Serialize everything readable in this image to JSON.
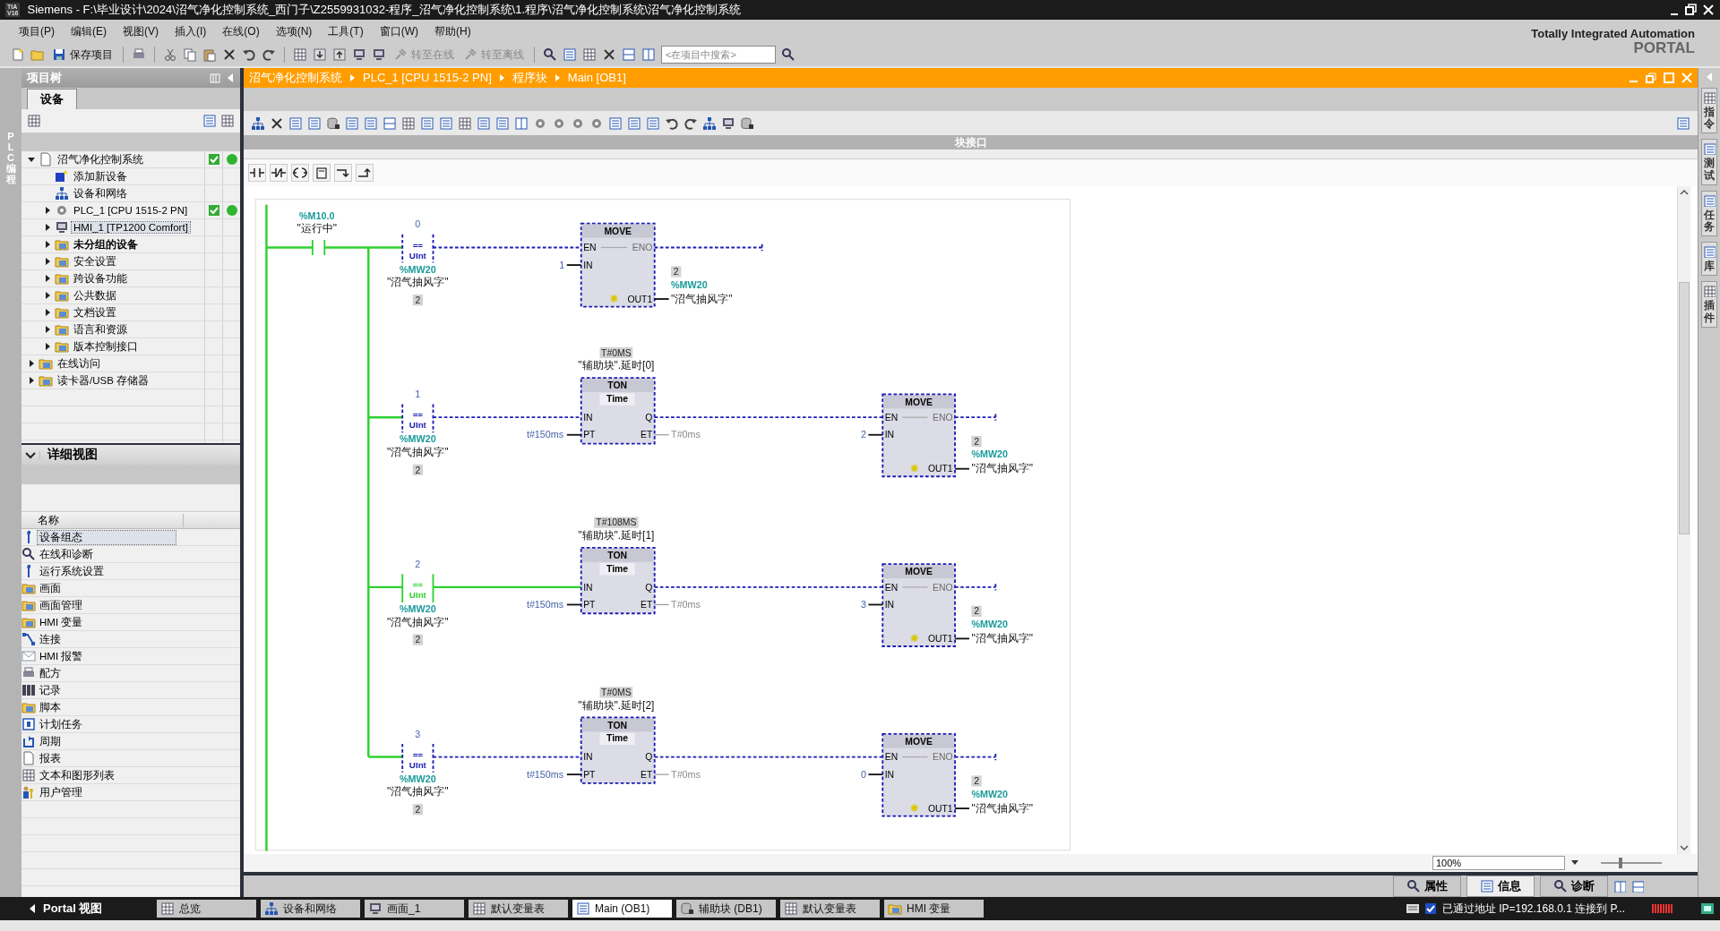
{
  "window": {
    "logo": [
      "TIA",
      "V16"
    ],
    "title": "Siemens  -  F:\\毕业设计\\2024\\沼气净化控制系统_西门子\\Z2559931032-程序_沼气净化控制系统\\1.程序\\沼气净化控制系统\\沼气净化控制系统"
  },
  "menu": [
    "项目(P)",
    "编辑(E)",
    "视图(V)",
    "插入(I)",
    "在线(O)",
    "选项(N)",
    "工具(T)",
    "窗口(W)",
    "帮助(H)"
  ],
  "toolbar": {
    "save_label": "保存项目",
    "go_online": {
      "label": "转至在线",
      "disabled": true
    },
    "go_offline": {
      "label": "转至离线",
      "disabled": true
    },
    "search": {
      "placeholder": "<在项目中搜索>"
    }
  },
  "brand": {
    "line1": "Totally Integrated Automation",
    "line2": "PORTAL"
  },
  "left_rail": {
    "label": "PLC 编程"
  },
  "project_tree": {
    "title": "项目树",
    "tabs": [
      {
        "label": "设备",
        "selected": true
      }
    ],
    "items": [
      {
        "label": "沼气净化控制系统",
        "kind": "folder",
        "expanded": true,
        "selected": false,
        "status_ok": true,
        "children": [
          {
            "label": "添加新设备",
            "kind": "action",
            "selected": false
          },
          {
            "label": "设备和网络",
            "kind": "action",
            "selected": false
          },
          {
            "label": "PLC_1 [CPU 1515-2 PN]",
            "kind": "folder",
            "expanded": false,
            "selected": false,
            "status_ok": true
          },
          {
            "label": "HMI_1 [TP1200 Comfort]",
            "kind": "folder",
            "expanded": false,
            "selected": true
          },
          {
            "label": "未分组的设备",
            "kind": "folder",
            "expanded": false,
            "selected": false,
            "bold": true
          },
          {
            "label": "安全设置",
            "kind": "folder",
            "expanded": false,
            "selected": false
          },
          {
            "label": "跨设备功能",
            "kind": "folder",
            "expanded": false,
            "selected": false
          },
          {
            "label": "公共数据",
            "kind": "folder",
            "expanded": false,
            "selected": false
          },
          {
            "label": "文档设置",
            "kind": "folder",
            "expanded": false,
            "selected": false
          },
          {
            "label": "语言和资源",
            "kind": "folder",
            "expanded": false,
            "selected": false
          },
          {
            "label": "版本控制接口",
            "kind": "folder",
            "expanded": false,
            "selected": false
          }
        ]
      },
      {
        "label": "在线访问",
        "kind": "folder",
        "expanded": false,
        "selected": false
      },
      {
        "label": "读卡器/USB 存储器",
        "kind": "folder",
        "expanded": false,
        "selected": false
      }
    ]
  },
  "details_view": {
    "title": "详细视图",
    "column": "名称",
    "items": [
      {
        "label": "设备组态",
        "selected": true
      },
      {
        "label": "在线和诊断",
        "selected": false
      },
      {
        "label": "运行系统设置",
        "selected": false
      },
      {
        "label": "画面",
        "selected": false
      },
      {
        "label": "画面管理",
        "selected": false
      },
      {
        "label": "HMI 变量",
        "selected": false
      },
      {
        "label": "连接",
        "selected": false
      },
      {
        "label": "HMI 报警",
        "selected": false
      },
      {
        "label": "配方",
        "selected": false
      },
      {
        "label": "记录",
        "selected": false
      },
      {
        "label": "脚本",
        "selected": false
      },
      {
        "label": "计划任务",
        "selected": false
      },
      {
        "label": "周期",
        "selected": false
      },
      {
        "label": "报表",
        "selected": false
      },
      {
        "label": "文本和图形列表",
        "selected": false
      },
      {
        "label": "用户管理",
        "selected": false
      }
    ]
  },
  "editor": {
    "breadcrumb": [
      "沼气净化控制系统",
      "PLC_1 [CPU 1515-2 PN]",
      "程序块",
      "Main [OB1]"
    ],
    "interface_bar": "块接口",
    "network": {
      "contact": {
        "address": "%M10.0",
        "name": "\"运行中\"",
        "closed": true
      },
      "rungs": [
        {
          "compare": {
            "value": "0",
            "op": "==",
            "type": "UInt",
            "address": "%MW20",
            "name": "\"沼气抽风字\"",
            "monitor": "2",
            "active": false
          },
          "move": {
            "title": "MOVE",
            "en": "EN",
            "eno": "ENO",
            "in_pin": "IN",
            "out_pin": "OUT1",
            "in_value": "1",
            "monitor": "2",
            "address": "%MW20",
            "name": "\"沼气抽风字\""
          }
        },
        {
          "compare": {
            "value": "1",
            "op": "==",
            "type": "UInt",
            "address": "%MW20",
            "name": "\"沼气抽风字\"",
            "monitor": "2",
            "active": false
          },
          "timer": {
            "monitor": "T#0MS",
            "instance": "\"辅助块\".延时[0]",
            "title": "TON",
            "type": "Time",
            "in_pin": "IN",
            "pt_pin": "PT",
            "q_pin": "Q",
            "et_pin": "ET",
            "preset": "t#150ms",
            "elapsed": "T#0ms"
          },
          "move": {
            "title": "MOVE",
            "en": "EN",
            "eno": "ENO",
            "in_pin": "IN",
            "out_pin": "OUT1",
            "in_value": "2",
            "monitor": "2",
            "address": "%MW20",
            "name": "\"沼气抽风字\""
          }
        },
        {
          "compare": {
            "value": "2",
            "op": "==",
            "type": "UInt",
            "address": "%MW20",
            "name": "\"沼气抽风字\"",
            "monitor": "2",
            "active": true
          },
          "timer": {
            "monitor": "T#108MS",
            "instance": "\"辅助块\".延时[1]",
            "title": "TON",
            "type": "Time",
            "in_pin": "IN",
            "pt_pin": "PT",
            "q_pin": "Q",
            "et_pin": "ET",
            "preset": "t#150ms",
            "elapsed": "T#0ms"
          },
          "move": {
            "title": "MOVE",
            "en": "EN",
            "eno": "ENO",
            "in_pin": "IN",
            "out_pin": "OUT1",
            "in_value": "3",
            "monitor": "2",
            "address": "%MW20",
            "name": "\"沼气抽风字\""
          }
        },
        {
          "compare": {
            "value": "3",
            "op": "==",
            "type": "UInt",
            "address": "%MW20",
            "name": "\"沼气抽风字\"",
            "monitor": "2",
            "active": false
          },
          "timer": {
            "monitor": "T#0MS",
            "instance": "\"辅助块\".延时[2]",
            "title": "TON",
            "type": "Time",
            "in_pin": "IN",
            "pt_pin": "PT",
            "q_pin": "Q",
            "et_pin": "ET",
            "preset": "t#150ms",
            "elapsed": "T#0ms"
          },
          "move": {
            "title": "MOVE",
            "en": "EN",
            "eno": "ENO",
            "in_pin": "IN",
            "out_pin": "OUT1",
            "in_value": "0",
            "monitor": "2",
            "address": "%MW20",
            "name": "\"沼气抽风字\""
          }
        }
      ]
    },
    "zoom": "100%",
    "zoom_slider": {
      "level": 0.32
    }
  },
  "right_rail": [
    {
      "label": "指令"
    },
    {
      "label": "测试"
    },
    {
      "label": "任务"
    },
    {
      "label": "库"
    },
    {
      "label": "插件"
    }
  ],
  "inspector_tabs": [
    {
      "label": "属性",
      "selected": false
    },
    {
      "label": "信息",
      "selected": true
    },
    {
      "label": "诊断",
      "selected": false
    }
  ],
  "taskbar": {
    "portal": "Portal 视图",
    "items": [
      {
        "label": "总览",
        "selected": false
      },
      {
        "label": "设备和网络",
        "selected": false
      },
      {
        "label": "画面_1",
        "selected": false
      },
      {
        "label": "默认变量表",
        "selected": false
      },
      {
        "label": "Main (OB1)",
        "selected": true
      },
      {
        "label": "辅助块 (DB1)",
        "selected": false
      },
      {
        "label": "默认变量表",
        "selected": false
      },
      {
        "label": "HMI 变量",
        "selected": false
      }
    ],
    "status": "已通过地址 IP=192.168.0.1 连接到 P..."
  }
}
